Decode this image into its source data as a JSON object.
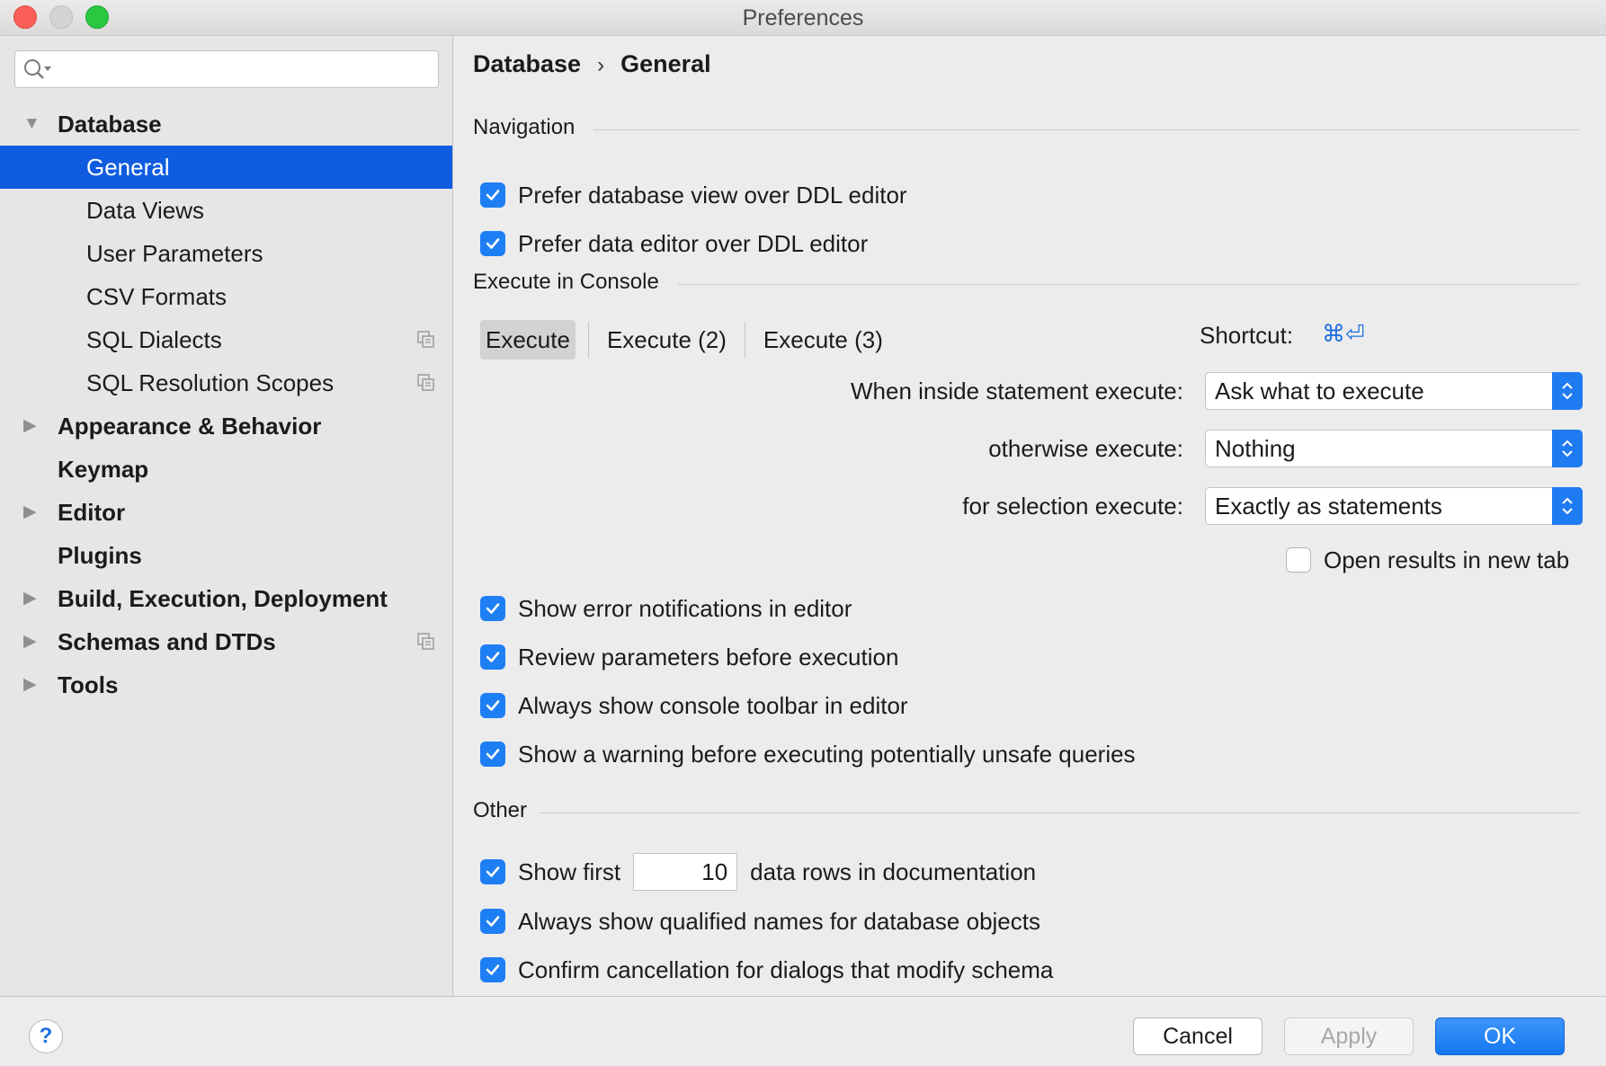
{
  "window": {
    "title": "Preferences"
  },
  "search": {
    "placeholder": "",
    "value": ""
  },
  "sidebar": {
    "items": [
      {
        "label": "Database",
        "level": "top",
        "expanded": true
      },
      {
        "label": "General",
        "level": "sub",
        "selected": true
      },
      {
        "label": "Data Views",
        "level": "sub"
      },
      {
        "label": "User Parameters",
        "level": "sub"
      },
      {
        "label": "CSV Formats",
        "level": "sub"
      },
      {
        "label": "SQL Dialects",
        "level": "sub",
        "has_copy_icon": true
      },
      {
        "label": "SQL Resolution Scopes",
        "level": "sub",
        "has_copy_icon": true
      },
      {
        "label": "Appearance & Behavior",
        "level": "top",
        "expandable": true
      },
      {
        "label": "Keymap",
        "level": "top"
      },
      {
        "label": "Editor",
        "level": "top",
        "expandable": true
      },
      {
        "label": "Plugins",
        "level": "top"
      },
      {
        "label": "Build, Execution, Deployment",
        "level": "top",
        "expandable": true
      },
      {
        "label": "Schemas and DTDs",
        "level": "top",
        "expandable": true,
        "has_copy_icon": true
      },
      {
        "label": "Tools",
        "level": "top",
        "expandable": true
      }
    ]
  },
  "breadcrumb": {
    "parent": "Database",
    "separator": "›",
    "current": "General"
  },
  "navigation": {
    "title": "Navigation",
    "options": [
      {
        "label": "Prefer database view over DDL editor",
        "checked": true
      },
      {
        "label": "Prefer data editor over DDL editor",
        "checked": true
      }
    ]
  },
  "execute": {
    "title": "Execute in Console",
    "tabs": [
      {
        "label": "Execute",
        "active": true
      },
      {
        "label": "Execute (2)"
      },
      {
        "label": "Execute (3)"
      }
    ],
    "shortcut_label": "Shortcut:",
    "shortcut_keys": "⌘⏎",
    "inside_label": "When inside statement execute:",
    "inside_value": "Ask what to execute",
    "otherwise_label": "otherwise execute:",
    "otherwise_value": "Nothing",
    "selection_label": "for selection execute:",
    "selection_value": "Exactly as statements",
    "open_results_label": "Open results in new tab",
    "open_results_checked": false,
    "options": [
      {
        "label": "Show error notifications in editor",
        "checked": true
      },
      {
        "label": "Review parameters before execution",
        "checked": true
      },
      {
        "label": "Always show console toolbar in editor",
        "checked": true
      },
      {
        "label": "Show a warning before executing potentially unsafe queries",
        "checked": true
      }
    ]
  },
  "other": {
    "title": "Other",
    "show_first_label": "Show first",
    "show_first_value": "10",
    "show_first_suffix": "data rows in documentation",
    "show_first_checked": true,
    "options": [
      {
        "label": "Always show qualified names for database objects",
        "checked": true
      },
      {
        "label": "Confirm cancellation for dialogs that modify schema",
        "checked": true
      }
    ]
  },
  "footer": {
    "help_label": "?",
    "cancel_label": "Cancel",
    "apply_label": "Apply",
    "ok_label": "OK"
  },
  "colors": {
    "accent": "#1e7ff5",
    "selection": "#0f5ce0"
  }
}
